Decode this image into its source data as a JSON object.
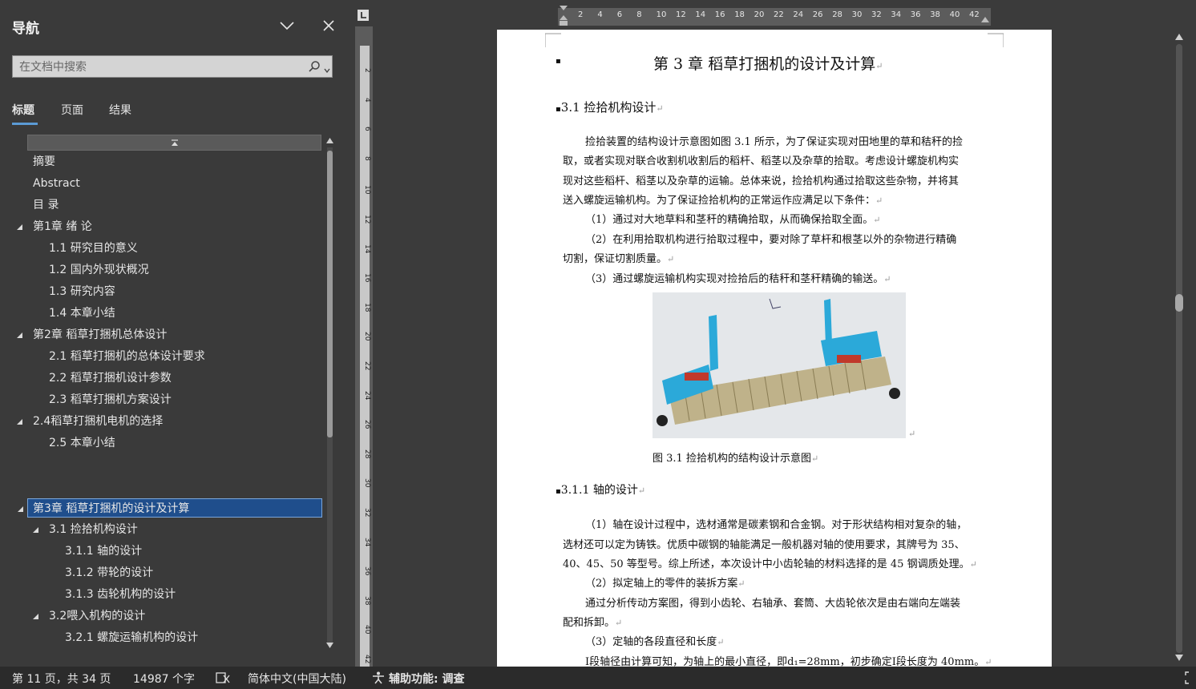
{
  "nav": {
    "title": "导航",
    "search_placeholder": "在文档中搜索",
    "tabs": [
      "标题",
      "页面",
      "结果"
    ],
    "tree": [
      {
        "label": "摘要",
        "level": 1,
        "expand": false
      },
      {
        "label": "Abstract",
        "level": 1,
        "expand": false
      },
      {
        "label": "目 录",
        "level": 1,
        "expand": false
      },
      {
        "label": "第1章 绪 论",
        "level": 1,
        "expand": true
      },
      {
        "label": "1.1 研究目的意义",
        "level": 2,
        "expand": false
      },
      {
        "label": "1.2 国内外现状概况",
        "level": 2,
        "expand": false
      },
      {
        "label": "1.3 研究内容",
        "level": 2,
        "expand": false
      },
      {
        "label": "1.4 本章小结",
        "level": 2,
        "expand": false
      },
      {
        "label": "第2章 稻草打捆机总体设计",
        "level": 1,
        "expand": true
      },
      {
        "label": "2.1 稻草打捆机的总体设计要求",
        "level": 2,
        "expand": false
      },
      {
        "label": "2.2 稻草打捆机设计参数",
        "level": 2,
        "expand": false
      },
      {
        "label": "2.3 稻草打捆机方案设计",
        "level": 2,
        "expand": false
      },
      {
        "label": "2.4稻草打捆机电机的选择",
        "level": 1,
        "expand": true
      },
      {
        "label": "2.5 本章小结",
        "level": 2,
        "expand": false
      },
      {
        "label": "第3章 稻草打捆机的设计及计算",
        "level": 1,
        "expand": true,
        "selected": true
      },
      {
        "label": "3.1 捡拾机构设计",
        "level": 2,
        "expand": true
      },
      {
        "label": "3.1.1 轴的设计",
        "level": 3,
        "expand": false
      },
      {
        "label": "3.1.2 带轮的设计",
        "level": 3,
        "expand": false
      },
      {
        "label": "3.1.3 齿轮机构的设计",
        "level": 3,
        "expand": false
      },
      {
        "label": "3.2喂入机构的设计",
        "level": 2,
        "expand": true
      },
      {
        "label": "3.2.1 螺旋运输机构的设计",
        "level": 3,
        "expand": false
      }
    ]
  },
  "ruler": {
    "h_labels": [
      "2",
      "4",
      "6",
      "8",
      "10",
      "12",
      "14",
      "16",
      "18",
      "20",
      "22",
      "24",
      "26",
      "28",
      "30",
      "32",
      "34",
      "36",
      "38",
      "40",
      "42"
    ],
    "v_labels": [
      "2",
      "4",
      "6",
      "8",
      "10",
      "12",
      "14",
      "16",
      "18",
      "20",
      "22",
      "24",
      "26",
      "28",
      "30",
      "32",
      "34",
      "36",
      "38",
      "40",
      "42"
    ]
  },
  "doc": {
    "chapter_title": "第 3 章  稻草打捆机的设计及计算",
    "section_31": "3.1  捡拾机构设计",
    "para1": [
      "捡拾装置的结构设计示意图如图 3.1 所示，为了保证实现对田地里的草和秸秆的捡",
      "取，或者实现对联合收割机收割后的稻杆、稻茎以及杂草的拾取。考虑设计螺旋机构实",
      "现对这些稻杆、稻茎以及杂草的运输。总体来说，捡拾机构通过拾取这些杂物，并将其",
      "送入螺旋运输机构。为了保证捡拾机构的正常运作应满足以下条件："
    ],
    "item1": "（1）通过对大地草料和茎秆的精确拾取，从而确保拾取全面。",
    "item2": [
      "（2）在利用拾取机构进行拾取过程中，要对除了草杆和根茎以外的杂物进行精确",
      "切割，保证切割质量。"
    ],
    "item3": "（3）通过螺旋运输机构实现对捡拾后的秸秆和茎秆精确的输送。",
    "figure_caption": "图 3.1    捡拾机构的结构设计示意图",
    "section_311": "3.1.1  轴的设计",
    "para2": [
      "（1）轴在设计过程中，选材通常是碳素钢和合金钢。对于形状结构相对复杂的轴，",
      "选材还可以定为铸铁。优质中碳钢的轴能满足一般机器对轴的使用要求，其牌号为 35、",
      "40、45、50 等型号。综上所述，本次设计中小齿轮轴的材料选择的是 45 钢调质处理。"
    ],
    "item_b": "（2）拟定轴上的零件的装拆方案",
    "para3": [
      "通过分析传动方案图，得到小齿轮、右轴承、套筒、大齿轮依次是由右端向左端装",
      "配和拆卸。"
    ],
    "item_c": "（3）定轴的各段直径和长度",
    "last_line": "Ⅰ段轴径由计算可知，为轴上的最小直径，即d₁=28mm，初步确定Ⅰ段长度为 40mm。"
  },
  "status": {
    "page": "第 11 页，共 34 页",
    "words": "14987 个字",
    "language": "简体中文(中国大陆)",
    "accessibility": "辅助功能: 调查"
  },
  "colors": {
    "selected_bg": "#1f4e8c",
    "accent": "#5b9bd5"
  }
}
